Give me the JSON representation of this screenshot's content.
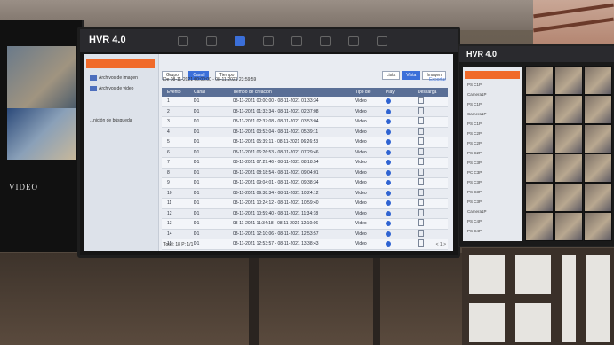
{
  "main_monitor": {
    "brand": "HVR 4.0",
    "sidebar": [
      {
        "label": "",
        "active": true
      },
      {
        "label": "Archivos de imagen",
        "active": false
      },
      {
        "label": "Archivos de video",
        "active": false
      },
      {
        "label": "...nición de búsqueda",
        "active": false
      }
    ],
    "tabs": [
      "Grupo",
      "Canal",
      "Tiempo"
    ],
    "view_toggles": [
      "Lista",
      "Vista",
      "Imagen"
    ],
    "date_range": "De 08-11-2021 00:00:00 - 08-11-2021 23:59:59",
    "export_label": "Exportar",
    "columns": [
      "Evento",
      "Canal",
      "Tiempo de creación",
      "Tipo de",
      "Play",
      "Descarga"
    ],
    "rows": [
      {
        "n": "1",
        "ch": "D1",
        "time": "08-11-2021 00:00:00 - 08-11-2021 01:33:34",
        "type": "Video"
      },
      {
        "n": "2",
        "ch": "D1",
        "time": "08-11-2021 01:33:34 - 08-11-2021 02:37:08",
        "type": "Video"
      },
      {
        "n": "3",
        "ch": "D1",
        "time": "08-11-2021 02:37:08 - 08-11-2021 03:53:04",
        "type": "Video"
      },
      {
        "n": "4",
        "ch": "D1",
        "time": "08-11-2021 03:53:04 - 08-11-2021 05:39:11",
        "type": "Video"
      },
      {
        "n": "5",
        "ch": "D1",
        "time": "08-11-2021 05:39:11 - 08-11-2021 06:26:53",
        "type": "Video"
      },
      {
        "n": "6",
        "ch": "D1",
        "time": "08-11-2021 06:26:53 - 08-11-2021 07:29:46",
        "type": "Video"
      },
      {
        "n": "7",
        "ch": "D1",
        "time": "08-11-2021 07:29:46 - 08-11-2021 08:18:54",
        "type": "Video"
      },
      {
        "n": "8",
        "ch": "D1",
        "time": "08-11-2021 08:18:54 - 08-11-2021 09:04:01",
        "type": "Video"
      },
      {
        "n": "9",
        "ch": "D1",
        "time": "08-11-2021 09:04:01 - 08-11-2021 09:38:34",
        "type": "Video"
      },
      {
        "n": "10",
        "ch": "D1",
        "time": "08-11-2021 09:38:34 - 08-11-2021 10:24:12",
        "type": "Video"
      },
      {
        "n": "11",
        "ch": "D1",
        "time": "08-11-2021 10:24:12 - 08-11-2021 10:59:40",
        "type": "Video"
      },
      {
        "n": "12",
        "ch": "D1",
        "time": "08-11-2021 10:59:40 - 08-11-2021 11:34:18",
        "type": "Video"
      },
      {
        "n": "13",
        "ch": "D1",
        "time": "08-11-2021 11:34:18 - 08-11-2021 12:10:06",
        "type": "Video"
      },
      {
        "n": "14",
        "ch": "D1",
        "time": "08-11-2021 12:10:06 - 08-11-2021 12:53:57",
        "type": "Video"
      },
      {
        "n": "15",
        "ch": "D1",
        "time": "08-11-2021 12:53:57 - 08-11-2021 13:38:43",
        "type": "Video"
      }
    ],
    "total": "Total: 18 P: 1/1",
    "pager": "< 1 >"
  },
  "left_monitor": {
    "label": "VIDEO"
  },
  "right_monitor": {
    "brand": "HVR 4.0",
    "items": [
      "",
      "PS C1P",
      "Camera1P",
      "PS C1P",
      "Camera1P",
      "PS C1P",
      "PS C2P",
      "PS C2P",
      "PS C2P",
      "PS C3P",
      "PC C3P",
      "PS C3P",
      "PS C3P",
      "PS C3P",
      "Camera1P",
      "PS C4P",
      "PS C4P"
    ]
  }
}
